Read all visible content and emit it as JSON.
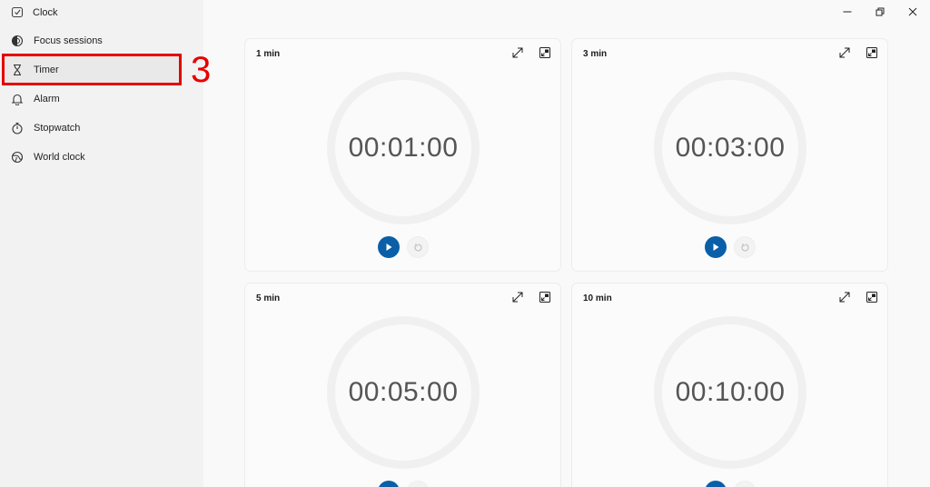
{
  "app": {
    "title": "Clock"
  },
  "sidebar": {
    "items": [
      {
        "label": "Focus sessions",
        "icon": "focus-icon"
      },
      {
        "label": "Timer",
        "icon": "hourglass-icon",
        "active": true
      },
      {
        "label": "Alarm",
        "icon": "bell-icon"
      },
      {
        "label": "Stopwatch",
        "icon": "stopwatch-icon"
      },
      {
        "label": "World clock",
        "icon": "globe-icon"
      }
    ]
  },
  "annotation": {
    "label": "3",
    "color": "#e60000"
  },
  "window_controls": [
    "minimize-icon",
    "restore-icon",
    "close-icon"
  ],
  "timers": [
    {
      "name": "1 min",
      "time": "00:01:00"
    },
    {
      "name": "3 min",
      "time": "00:03:00"
    },
    {
      "name": "5 min",
      "time": "00:05:00"
    },
    {
      "name": "10 min",
      "time": "00:10:00"
    }
  ],
  "colors": {
    "accent": "#0a5fa8",
    "highlight": "#e60000"
  }
}
